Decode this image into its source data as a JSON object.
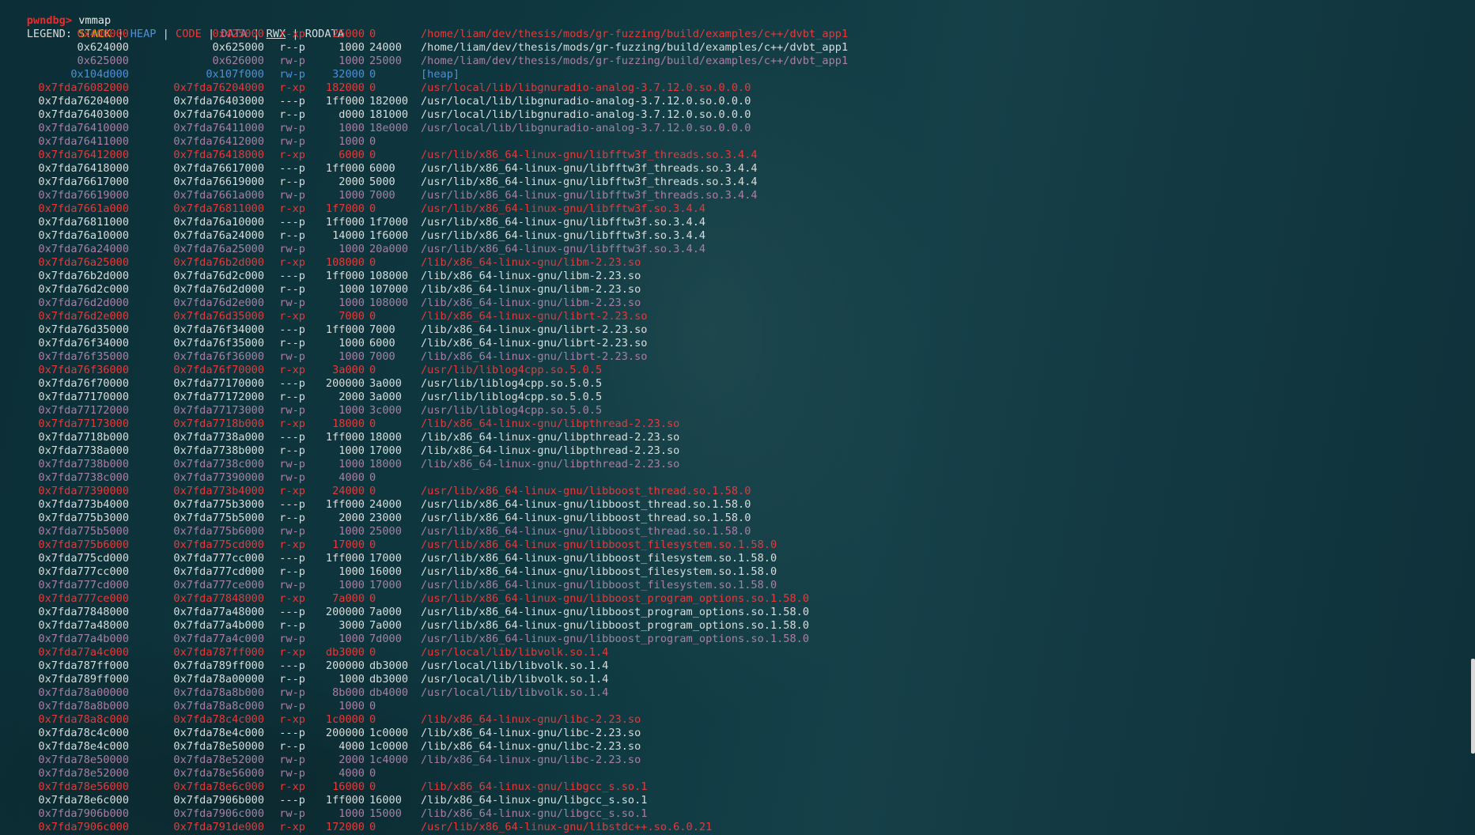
{
  "prompt": {
    "name": "pwndbg>",
    "command": "vmmap"
  },
  "legend": {
    "label": "LEGEND:",
    "stack": "STACK",
    "heap": "HEAP",
    "code": "CODE",
    "data": "DATA",
    "rwx": "RWX",
    "rodata": "RODATA",
    "separator": "|"
  },
  "colors": {
    "code": "#e53a3a",
    "data": "#a97fa6",
    "heap": "#4f8fd6",
    "stack": "#f0c000",
    "rodata": "#d8dcdc",
    "prompt": "#ef2929"
  },
  "mappings": [
    {
      "start": "0x400000",
      "end": "0x425000",
      "perm": "r-xp",
      "size": "25000",
      "offset": "0",
      "path": "/home/liam/dev/thesis/mods/gr-fuzzing/build/examples/c++/dvbt_app1",
      "type": "code"
    },
    {
      "start": "0x624000",
      "end": "0x625000",
      "perm": "r--p",
      "size": "1000",
      "offset": "24000",
      "path": "/home/liam/dev/thesis/mods/gr-fuzzing/build/examples/c++/dvbt_app1",
      "type": "rodata"
    },
    {
      "start": "0x625000",
      "end": "0x626000",
      "perm": "rw-p",
      "size": "1000",
      "offset": "25000",
      "path": "/home/liam/dev/thesis/mods/gr-fuzzing/build/examples/c++/dvbt_app1",
      "type": "data"
    },
    {
      "start": "0x104d000",
      "end": "0x107f000",
      "perm": "rw-p",
      "size": "32000",
      "offset": "0",
      "path": "[heap]",
      "type": "heap"
    },
    {
      "start": "0x7fda76082000",
      "end": "0x7fda76204000",
      "perm": "r-xp",
      "size": "182000",
      "offset": "0",
      "path": "/usr/local/lib/libgnuradio-analog-3.7.12.0.so.0.0.0",
      "type": "code"
    },
    {
      "start": "0x7fda76204000",
      "end": "0x7fda76403000",
      "perm": "---p",
      "size": "1ff000",
      "offset": "182000",
      "path": "/usr/local/lib/libgnuradio-analog-3.7.12.0.so.0.0.0",
      "type": "rodata"
    },
    {
      "start": "0x7fda76403000",
      "end": "0x7fda76410000",
      "perm": "r--p",
      "size": "d000",
      "offset": "181000",
      "path": "/usr/local/lib/libgnuradio-analog-3.7.12.0.so.0.0.0",
      "type": "rodata"
    },
    {
      "start": "0x7fda76410000",
      "end": "0x7fda76411000",
      "perm": "rw-p",
      "size": "1000",
      "offset": "18e000",
      "path": "/usr/local/lib/libgnuradio-analog-3.7.12.0.so.0.0.0",
      "type": "data"
    },
    {
      "start": "0x7fda76411000",
      "end": "0x7fda76412000",
      "perm": "rw-p",
      "size": "1000",
      "offset": "0",
      "path": "",
      "type": "data"
    },
    {
      "start": "0x7fda76412000",
      "end": "0x7fda76418000",
      "perm": "r-xp",
      "size": "6000",
      "offset": "0",
      "path": "/usr/lib/x86_64-linux-gnu/libfftw3f_threads.so.3.4.4",
      "type": "code"
    },
    {
      "start": "0x7fda76418000",
      "end": "0x7fda76617000",
      "perm": "---p",
      "size": "1ff000",
      "offset": "6000",
      "path": "/usr/lib/x86_64-linux-gnu/libfftw3f_threads.so.3.4.4",
      "type": "rodata"
    },
    {
      "start": "0x7fda76617000",
      "end": "0x7fda76619000",
      "perm": "r--p",
      "size": "2000",
      "offset": "5000",
      "path": "/usr/lib/x86_64-linux-gnu/libfftw3f_threads.so.3.4.4",
      "type": "rodata"
    },
    {
      "start": "0x7fda76619000",
      "end": "0x7fda7661a000",
      "perm": "rw-p",
      "size": "1000",
      "offset": "7000",
      "path": "/usr/lib/x86_64-linux-gnu/libfftw3f_threads.so.3.4.4",
      "type": "data"
    },
    {
      "start": "0x7fda7661a000",
      "end": "0x7fda76811000",
      "perm": "r-xp",
      "size": "1f7000",
      "offset": "0",
      "path": "/usr/lib/x86_64-linux-gnu/libfftw3f.so.3.4.4",
      "type": "code"
    },
    {
      "start": "0x7fda76811000",
      "end": "0x7fda76a10000",
      "perm": "---p",
      "size": "1ff000",
      "offset": "1f7000",
      "path": "/usr/lib/x86_64-linux-gnu/libfftw3f.so.3.4.4",
      "type": "rodata"
    },
    {
      "start": "0x7fda76a10000",
      "end": "0x7fda76a24000",
      "perm": "r--p",
      "size": "14000",
      "offset": "1f6000",
      "path": "/usr/lib/x86_64-linux-gnu/libfftw3f.so.3.4.4",
      "type": "rodata"
    },
    {
      "start": "0x7fda76a24000",
      "end": "0x7fda76a25000",
      "perm": "rw-p",
      "size": "1000",
      "offset": "20a000",
      "path": "/usr/lib/x86_64-linux-gnu/libfftw3f.so.3.4.4",
      "type": "data"
    },
    {
      "start": "0x7fda76a25000",
      "end": "0x7fda76b2d000",
      "perm": "r-xp",
      "size": "108000",
      "offset": "0",
      "path": "/lib/x86_64-linux-gnu/libm-2.23.so",
      "type": "code"
    },
    {
      "start": "0x7fda76b2d000",
      "end": "0x7fda76d2c000",
      "perm": "---p",
      "size": "1ff000",
      "offset": "108000",
      "path": "/lib/x86_64-linux-gnu/libm-2.23.so",
      "type": "rodata"
    },
    {
      "start": "0x7fda76d2c000",
      "end": "0x7fda76d2d000",
      "perm": "r--p",
      "size": "1000",
      "offset": "107000",
      "path": "/lib/x86_64-linux-gnu/libm-2.23.so",
      "type": "rodata"
    },
    {
      "start": "0x7fda76d2d000",
      "end": "0x7fda76d2e000",
      "perm": "rw-p",
      "size": "1000",
      "offset": "108000",
      "path": "/lib/x86_64-linux-gnu/libm-2.23.so",
      "type": "data"
    },
    {
      "start": "0x7fda76d2e000",
      "end": "0x7fda76d35000",
      "perm": "r-xp",
      "size": "7000",
      "offset": "0",
      "path": "/lib/x86_64-linux-gnu/librt-2.23.so",
      "type": "code"
    },
    {
      "start": "0x7fda76d35000",
      "end": "0x7fda76f34000",
      "perm": "---p",
      "size": "1ff000",
      "offset": "7000",
      "path": "/lib/x86_64-linux-gnu/librt-2.23.so",
      "type": "rodata"
    },
    {
      "start": "0x7fda76f34000",
      "end": "0x7fda76f35000",
      "perm": "r--p",
      "size": "1000",
      "offset": "6000",
      "path": "/lib/x86_64-linux-gnu/librt-2.23.so",
      "type": "rodata"
    },
    {
      "start": "0x7fda76f35000",
      "end": "0x7fda76f36000",
      "perm": "rw-p",
      "size": "1000",
      "offset": "7000",
      "path": "/lib/x86_64-linux-gnu/librt-2.23.so",
      "type": "data"
    },
    {
      "start": "0x7fda76f36000",
      "end": "0x7fda76f70000",
      "perm": "r-xp",
      "size": "3a000",
      "offset": "0",
      "path": "/usr/lib/liblog4cpp.so.5.0.5",
      "type": "code"
    },
    {
      "start": "0x7fda76f70000",
      "end": "0x7fda77170000",
      "perm": "---p",
      "size": "200000",
      "offset": "3a000",
      "path": "/usr/lib/liblog4cpp.so.5.0.5",
      "type": "rodata"
    },
    {
      "start": "0x7fda77170000",
      "end": "0x7fda77172000",
      "perm": "r--p",
      "size": "2000",
      "offset": "3a000",
      "path": "/usr/lib/liblog4cpp.so.5.0.5",
      "type": "rodata"
    },
    {
      "start": "0x7fda77172000",
      "end": "0x7fda77173000",
      "perm": "rw-p",
      "size": "1000",
      "offset": "3c000",
      "path": "/usr/lib/liblog4cpp.so.5.0.5",
      "type": "data"
    },
    {
      "start": "0x7fda77173000",
      "end": "0x7fda7718b000",
      "perm": "r-xp",
      "size": "18000",
      "offset": "0",
      "path": "/lib/x86_64-linux-gnu/libpthread-2.23.so",
      "type": "code"
    },
    {
      "start": "0x7fda7718b000",
      "end": "0x7fda7738a000",
      "perm": "---p",
      "size": "1ff000",
      "offset": "18000",
      "path": "/lib/x86_64-linux-gnu/libpthread-2.23.so",
      "type": "rodata"
    },
    {
      "start": "0x7fda7738a000",
      "end": "0x7fda7738b000",
      "perm": "r--p",
      "size": "1000",
      "offset": "17000",
      "path": "/lib/x86_64-linux-gnu/libpthread-2.23.so",
      "type": "rodata"
    },
    {
      "start": "0x7fda7738b000",
      "end": "0x7fda7738c000",
      "perm": "rw-p",
      "size": "1000",
      "offset": "18000",
      "path": "/lib/x86_64-linux-gnu/libpthread-2.23.so",
      "type": "data"
    },
    {
      "start": "0x7fda7738c000",
      "end": "0x7fda77390000",
      "perm": "rw-p",
      "size": "4000",
      "offset": "0",
      "path": "",
      "type": "data"
    },
    {
      "start": "0x7fda77390000",
      "end": "0x7fda773b4000",
      "perm": "r-xp",
      "size": "24000",
      "offset": "0",
      "path": "/usr/lib/x86_64-linux-gnu/libboost_thread.so.1.58.0",
      "type": "code"
    },
    {
      "start": "0x7fda773b4000",
      "end": "0x7fda775b3000",
      "perm": "---p",
      "size": "1ff000",
      "offset": "24000",
      "path": "/usr/lib/x86_64-linux-gnu/libboost_thread.so.1.58.0",
      "type": "rodata"
    },
    {
      "start": "0x7fda775b3000",
      "end": "0x7fda775b5000",
      "perm": "r--p",
      "size": "2000",
      "offset": "23000",
      "path": "/usr/lib/x86_64-linux-gnu/libboost_thread.so.1.58.0",
      "type": "rodata"
    },
    {
      "start": "0x7fda775b5000",
      "end": "0x7fda775b6000",
      "perm": "rw-p",
      "size": "1000",
      "offset": "25000",
      "path": "/usr/lib/x86_64-linux-gnu/libboost_thread.so.1.58.0",
      "type": "data"
    },
    {
      "start": "0x7fda775b6000",
      "end": "0x7fda775cd000",
      "perm": "r-xp",
      "size": "17000",
      "offset": "0",
      "path": "/usr/lib/x86_64-linux-gnu/libboost_filesystem.so.1.58.0",
      "type": "code"
    },
    {
      "start": "0x7fda775cd000",
      "end": "0x7fda777cc000",
      "perm": "---p",
      "size": "1ff000",
      "offset": "17000",
      "path": "/usr/lib/x86_64-linux-gnu/libboost_filesystem.so.1.58.0",
      "type": "rodata"
    },
    {
      "start": "0x7fda777cc000",
      "end": "0x7fda777cd000",
      "perm": "r--p",
      "size": "1000",
      "offset": "16000",
      "path": "/usr/lib/x86_64-linux-gnu/libboost_filesystem.so.1.58.0",
      "type": "rodata"
    },
    {
      "start": "0x7fda777cd000",
      "end": "0x7fda777ce000",
      "perm": "rw-p",
      "size": "1000",
      "offset": "17000",
      "path": "/usr/lib/x86_64-linux-gnu/libboost_filesystem.so.1.58.0",
      "type": "data"
    },
    {
      "start": "0x7fda777ce000",
      "end": "0x7fda77848000",
      "perm": "r-xp",
      "size": "7a000",
      "offset": "0",
      "path": "/usr/lib/x86_64-linux-gnu/libboost_program_options.so.1.58.0",
      "type": "code"
    },
    {
      "start": "0x7fda77848000",
      "end": "0x7fda77a48000",
      "perm": "---p",
      "size": "200000",
      "offset": "7a000",
      "path": "/usr/lib/x86_64-linux-gnu/libboost_program_options.so.1.58.0",
      "type": "rodata"
    },
    {
      "start": "0x7fda77a48000",
      "end": "0x7fda77a4b000",
      "perm": "r--p",
      "size": "3000",
      "offset": "7a000",
      "path": "/usr/lib/x86_64-linux-gnu/libboost_program_options.so.1.58.0",
      "type": "rodata"
    },
    {
      "start": "0x7fda77a4b000",
      "end": "0x7fda77a4c000",
      "perm": "rw-p",
      "size": "1000",
      "offset": "7d000",
      "path": "/usr/lib/x86_64-linux-gnu/libboost_program_options.so.1.58.0",
      "type": "data"
    },
    {
      "start": "0x7fda77a4c000",
      "end": "0x7fda787ff000",
      "perm": "r-xp",
      "size": "db3000",
      "offset": "0",
      "path": "/usr/local/lib/libvolk.so.1.4",
      "type": "code"
    },
    {
      "start": "0x7fda787ff000",
      "end": "0x7fda789ff000",
      "perm": "---p",
      "size": "200000",
      "offset": "db3000",
      "path": "/usr/local/lib/libvolk.so.1.4",
      "type": "rodata"
    },
    {
      "start": "0x7fda789ff000",
      "end": "0x7fda78a00000",
      "perm": "r--p",
      "size": "1000",
      "offset": "db3000",
      "path": "/usr/local/lib/libvolk.so.1.4",
      "type": "rodata"
    },
    {
      "start": "0x7fda78a00000",
      "end": "0x7fda78a8b000",
      "perm": "rw-p",
      "size": "8b000",
      "offset": "db4000",
      "path": "/usr/local/lib/libvolk.so.1.4",
      "type": "data"
    },
    {
      "start": "0x7fda78a8b000",
      "end": "0x7fda78a8c000",
      "perm": "rw-p",
      "size": "1000",
      "offset": "0",
      "path": "",
      "type": "data"
    },
    {
      "start": "0x7fda78a8c000",
      "end": "0x7fda78c4c000",
      "perm": "r-xp",
      "size": "1c0000",
      "offset": "0",
      "path": "/lib/x86_64-linux-gnu/libc-2.23.so",
      "type": "code"
    },
    {
      "start": "0x7fda78c4c000",
      "end": "0x7fda78e4c000",
      "perm": "---p",
      "size": "200000",
      "offset": "1c0000",
      "path": "/lib/x86_64-linux-gnu/libc-2.23.so",
      "type": "rodata"
    },
    {
      "start": "0x7fda78e4c000",
      "end": "0x7fda78e50000",
      "perm": "r--p",
      "size": "4000",
      "offset": "1c0000",
      "path": "/lib/x86_64-linux-gnu/libc-2.23.so",
      "type": "rodata"
    },
    {
      "start": "0x7fda78e50000",
      "end": "0x7fda78e52000",
      "perm": "rw-p",
      "size": "2000",
      "offset": "1c4000",
      "path": "/lib/x86_64-linux-gnu/libc-2.23.so",
      "type": "data"
    },
    {
      "start": "0x7fda78e52000",
      "end": "0x7fda78e56000",
      "perm": "rw-p",
      "size": "4000",
      "offset": "0",
      "path": "",
      "type": "data"
    },
    {
      "start": "0x7fda78e56000",
      "end": "0x7fda78e6c000",
      "perm": "r-xp",
      "size": "16000",
      "offset": "0",
      "path": "/lib/x86_64-linux-gnu/libgcc_s.so.1",
      "type": "code"
    },
    {
      "start": "0x7fda78e6c000",
      "end": "0x7fda7906b000",
      "perm": "---p",
      "size": "1ff000",
      "offset": "16000",
      "path": "/lib/x86_64-linux-gnu/libgcc_s.so.1",
      "type": "rodata"
    },
    {
      "start": "0x7fda7906b000",
      "end": "0x7fda7906c000",
      "perm": "rw-p",
      "size": "1000",
      "offset": "15000",
      "path": "/lib/x86_64-linux-gnu/libgcc_s.so.1",
      "type": "data"
    },
    {
      "start": "0x7fda7906c000",
      "end": "0x7fda791de000",
      "perm": "r-xp",
      "size": "172000",
      "offset": "0",
      "path": "/usr/lib/x86_64-linux-gnu/libstdc++.so.6.0.21",
      "type": "code"
    }
  ]
}
